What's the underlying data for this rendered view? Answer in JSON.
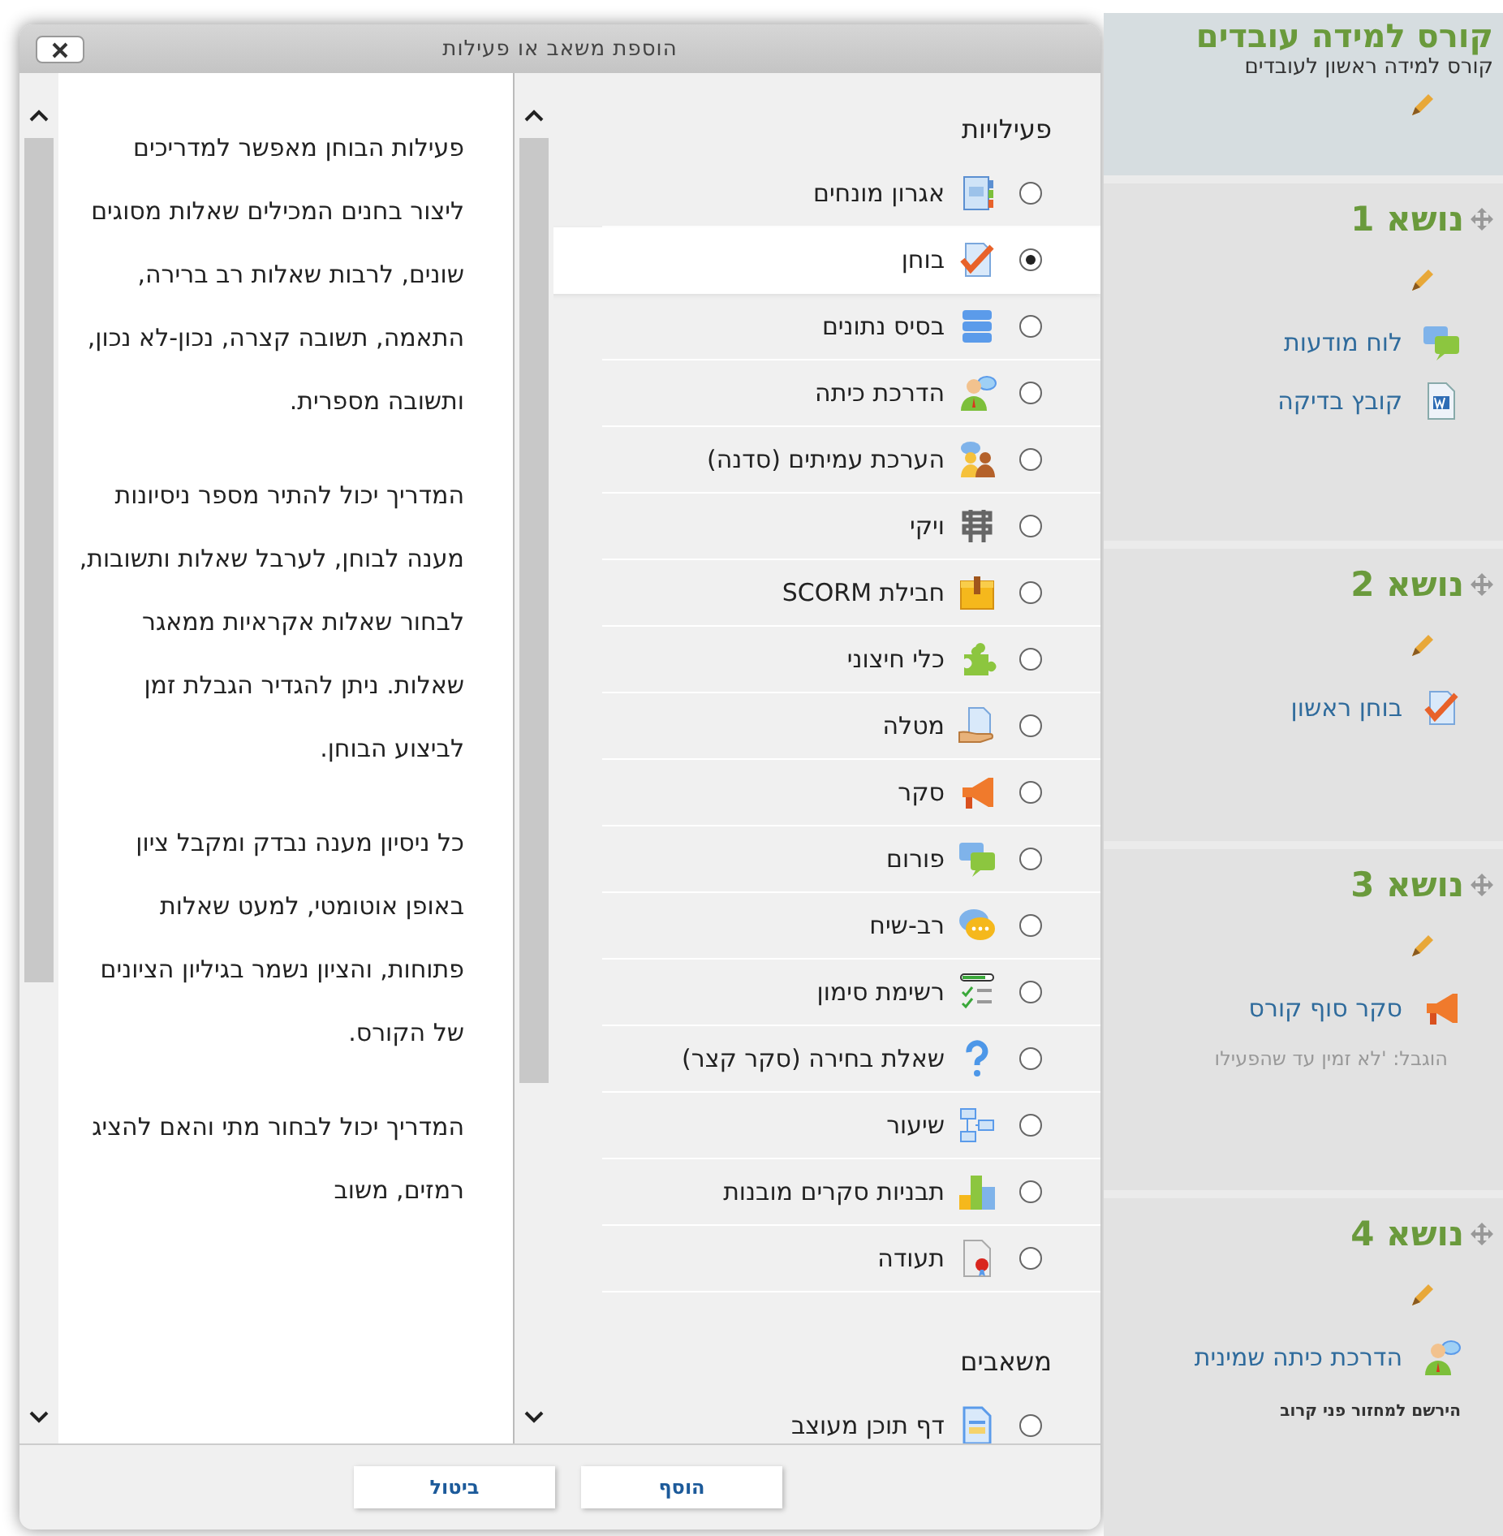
{
  "dialog": {
    "title": "הוספת משאב או פעילות",
    "description": {
      "paragraphs": [
        "פעילות הבוחן מאפשר למדריכים ליצור בחנים המכילים שאלות מסוגים שונים, לרבות שאלות רב ברירה, התאמה, תשובה קצרה, נכון-לא נכון, ותשובה מספרית.",
        "המדריך יכול להתיר מספר ניסיונות מענה לבוחן, לערבל שאלות ותשובות, לבחור שאלות אקראיות ממאגר שאלות. ניתן להגדיר הגבלת זמן לביצוע הבוחן.",
        "כל ניסיון מענה נבדק ומקבל ציון באופן אוטומטי, למעט שאלות פתוחות, והציון נשמר בגיליון הציונים של הקורס.",
        "המדריך יכול לבחור מתי והאם להציג רמזים, משוב"
      ]
    },
    "sections": [
      {
        "heading": "פעילויות",
        "options": [
          {
            "label": "אגרון מונחים",
            "kind": "glossary",
            "selected": false
          },
          {
            "label": "בוחן",
            "kind": "quiz",
            "selected": true
          },
          {
            "label": "בסיס נתונים",
            "kind": "database",
            "selected": false
          },
          {
            "label": "הדרכת כיתה",
            "kind": "classroom",
            "selected": false
          },
          {
            "label": "הערכת עמיתים (סדנה)",
            "kind": "workshop",
            "selected": false
          },
          {
            "label": "ויקי",
            "kind": "wiki",
            "selected": false
          },
          {
            "label": "חבילת SCORM",
            "kind": "scorm",
            "selected": false
          },
          {
            "label": "כלי חיצוני",
            "kind": "lti",
            "selected": false
          },
          {
            "label": "מטלה",
            "kind": "assignment",
            "selected": false
          },
          {
            "label": "סקר",
            "kind": "survey",
            "selected": false
          },
          {
            "label": "פורום",
            "kind": "forum",
            "selected": false
          },
          {
            "label": "רב-שיח",
            "kind": "chat",
            "selected": false
          },
          {
            "label": "רשימת סימון",
            "kind": "checklist",
            "selected": false
          },
          {
            "label": "שאלת בחירה (סקר קצר)",
            "kind": "choice",
            "selected": false
          },
          {
            "label": "שיעור",
            "kind": "lesson",
            "selected": false
          },
          {
            "label": "תבניות סקרים מובנות",
            "kind": "chart",
            "selected": false
          },
          {
            "label": "תעודה",
            "kind": "certificate",
            "selected": false
          }
        ]
      },
      {
        "heading": "משאבים",
        "options": [
          {
            "label": "דף תוכן מעוצב",
            "kind": "page",
            "selected": false
          }
        ]
      }
    ],
    "buttons": [
      {
        "label": "הוסף"
      },
      {
        "label": "ביטול"
      }
    ]
  },
  "course": {
    "title": "קורס למידה עובדים",
    "subtitle": "קורס למידה ראשון לעובדים",
    "topics": [
      {
        "title": "נושא 1",
        "items": [
          {
            "label": "לוח מודעות",
            "kind": "forum"
          },
          {
            "label": "קובץ בדיקה",
            "kind": "file"
          }
        ]
      },
      {
        "title": "נושא 2",
        "items": [
          {
            "label": "בוחן ראשון",
            "kind": "quiz"
          }
        ]
      },
      {
        "title": "נושא 3",
        "items": [
          {
            "label": "סקר סוף קורס",
            "kind": "survey"
          }
        ],
        "restriction": "הוגבל: 'לא זמין עד שהפעילו"
      },
      {
        "title": "נושא 4",
        "items": [
          {
            "label": "הדרכת כיתה שמינית",
            "kind": "classroom"
          }
        ],
        "note": "הירשם למחזור פני קרוב"
      }
    ]
  }
}
